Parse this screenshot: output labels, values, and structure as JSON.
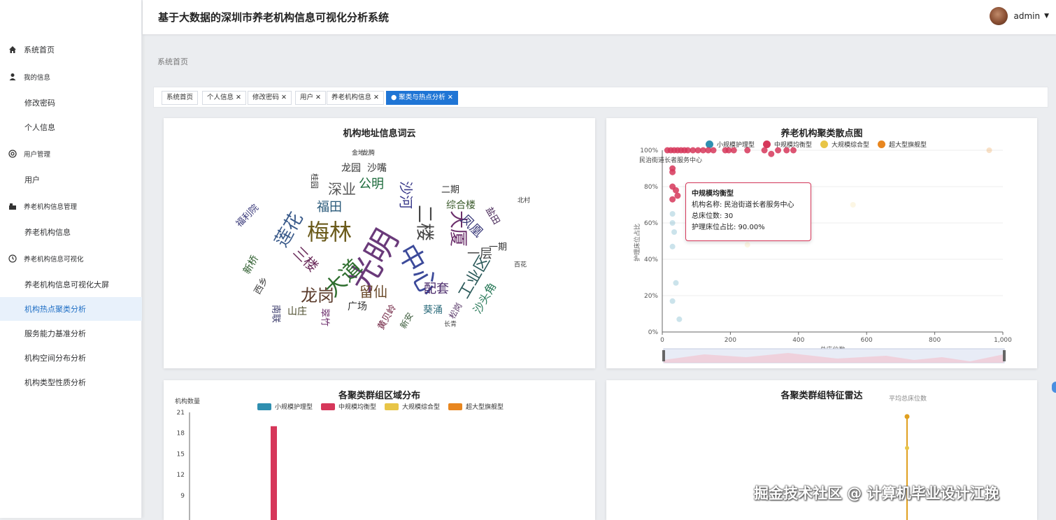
{
  "header": {
    "title": "基于大数据的深圳市养老机构信息可视化分析系统",
    "user": "admin"
  },
  "sidebar": {
    "items": [
      {
        "label": "系统首页",
        "icon": "home-icon",
        "type": "top"
      },
      {
        "label": "我的信息",
        "icon": "user-icon",
        "type": "group"
      },
      {
        "label": "修改密码",
        "type": "sub"
      },
      {
        "label": "个人信息",
        "type": "sub"
      },
      {
        "label": "用户管理",
        "icon": "users-icon",
        "type": "group"
      },
      {
        "label": "用户",
        "type": "sub"
      },
      {
        "label": "养老机构信息管理",
        "icon": "building-icon",
        "type": "group"
      },
      {
        "label": "养老机构信息",
        "type": "sub"
      },
      {
        "label": "养老机构信息可视化",
        "icon": "clock-icon",
        "type": "group"
      },
      {
        "label": "养老机构信息可视化大屏",
        "type": "sub"
      },
      {
        "label": "机构热点聚类分析",
        "type": "sub",
        "active": true
      },
      {
        "label": "服务能力基准分析",
        "type": "sub"
      },
      {
        "label": "机构空间分布分析",
        "type": "sub"
      },
      {
        "label": "机构类型性质分析",
        "type": "sub"
      }
    ]
  },
  "breadcrumb": "系统首页",
  "tabs": [
    {
      "label": "系统首页",
      "closable": false
    },
    {
      "label": "个人信息",
      "closable": true
    },
    {
      "label": "修改密码",
      "closable": true
    },
    {
      "label": "用户",
      "closable": true
    },
    {
      "label": "养老机构信息",
      "closable": true
    },
    {
      "label": "聚类与热点分析",
      "closable": true,
      "active": true
    }
  ],
  "colors": {
    "small": "#2f8fb0",
    "medium": "#d6375a",
    "large": "#e8c547",
    "xl": "#e8861f",
    "accent": "#1f75d5"
  },
  "wordcloud": {
    "title": "机构地址信息词云",
    "words": [
      {
        "text": "光明",
        "size": 46,
        "color": "#6a3a7a",
        "rot": -60
      },
      {
        "text": "中心",
        "size": 38,
        "color": "#3c4a9a",
        "rot": 60
      },
      {
        "text": "梅林",
        "size": 32,
        "color": "#6a5a1a",
        "rot": 0
      },
      {
        "text": "大道",
        "size": 30,
        "color": "#2e6e2e",
        "rot": -45
      },
      {
        "text": "莲花",
        "size": 26,
        "color": "#3a5a8a",
        "rot": -60
      },
      {
        "text": "二楼",
        "size": 26,
        "color": "#444",
        "rot": 90
      },
      {
        "text": "大厦",
        "size": 26,
        "color": "#6b2f6b",
        "rot": 90
      },
      {
        "text": "龙岗",
        "size": 24,
        "color": "#5a3a2a",
        "rot": 0
      },
      {
        "text": "工业区",
        "size": 22,
        "color": "#2b5a5a",
        "rot": -60
      },
      {
        "text": "深业",
        "size": 20,
        "color": "#555",
        "rot": 0
      },
      {
        "text": "三楼",
        "size": 20,
        "color": "#6a2a5a",
        "rot": 45
      },
      {
        "text": "沙河",
        "size": 20,
        "color": "#3a3a8a",
        "rot": 90
      },
      {
        "text": "留仙",
        "size": 20,
        "color": "#6a4a2a",
        "rot": 0
      },
      {
        "text": "福田",
        "size": 18,
        "color": "#2a5a7a",
        "rot": 0
      },
      {
        "text": "配套",
        "size": 18,
        "color": "#4a2a6a",
        "rot": 0
      },
      {
        "text": "公明",
        "size": 18,
        "color": "#1a6a3a",
        "rot": 0
      },
      {
        "text": "凤凰",
        "size": 18,
        "color": "#3a3a7a",
        "rot": 45
      },
      {
        "text": "一层",
        "size": 18,
        "color": "#444",
        "rot": 0
      },
      {
        "text": "沙头角",
        "size": 16,
        "color": "#2a7a5a",
        "rot": -60
      },
      {
        "text": "综合楼",
        "size": 14,
        "color": "#3a5a2a",
        "rot": 0
      },
      {
        "text": "龙园",
        "size": 14,
        "color": "#333",
        "rot": 0
      },
      {
        "text": "沙嘴",
        "size": 14,
        "color": "#333",
        "rot": 0
      },
      {
        "text": "广场",
        "size": 14,
        "color": "#333",
        "rot": 0
      },
      {
        "text": "葵涌",
        "size": 14,
        "color": "#2a6a7a",
        "rot": 0
      },
      {
        "text": "山庄",
        "size": 14,
        "color": "#4a4a2a",
        "rot": 0
      },
      {
        "text": "新桥",
        "size": 14,
        "color": "#2a5a2a",
        "rot": -60
      },
      {
        "text": "南联",
        "size": 13,
        "color": "#3a3a6a",
        "rot": 90
      },
      {
        "text": "翠竹",
        "size": 13,
        "color": "#6a2a6a",
        "rot": 90
      },
      {
        "text": "二期",
        "size": 13,
        "color": "#333",
        "rot": 0
      },
      {
        "text": "一期",
        "size": 13,
        "color": "#333",
        "rot": 0
      },
      {
        "text": "黄贝岭",
        "size": 13,
        "color": "#6a1a3a",
        "rot": -60
      },
      {
        "text": "西乡",
        "size": 13,
        "color": "#444",
        "rot": -60
      },
      {
        "text": "盐田",
        "size": 13,
        "color": "#4a2a5a",
        "rot": 60
      },
      {
        "text": "福利院",
        "size": 13,
        "color": "#3a3a7a",
        "rot": -45
      },
      {
        "text": "松岗",
        "size": 12,
        "color": "#5a3a6a",
        "rot": -60
      },
      {
        "text": "新安",
        "size": 12,
        "color": "#3a5a3a",
        "rot": -60
      },
      {
        "text": "桂园",
        "size": 11,
        "color": "#333",
        "rot": 90
      },
      {
        "text": "长青",
        "size": 9,
        "color": "#444",
        "rot": 0
      },
      {
        "text": "金地",
        "size": 9,
        "color": "#333",
        "rot": 0
      },
      {
        "text": "龙腾",
        "size": 9,
        "color": "#333",
        "rot": 0
      },
      {
        "text": "百花",
        "size": 9,
        "color": "#333",
        "rot": 0
      },
      {
        "text": "北村",
        "size": 9,
        "color": "#333",
        "rot": 0
      }
    ]
  },
  "scatter": {
    "title": "养老机构聚类散点图",
    "legend": [
      "小规模护理型",
      "中规模均衡型",
      "大规模综合型",
      "超大型旗舰型"
    ],
    "xlabel": "总床位数",
    "ylabel": "护理床位占比",
    "xticks": [
      "0",
      "200",
      "400",
      "600",
      "800",
      "1,000"
    ],
    "yticks": [
      "0%",
      "20%",
      "40%",
      "60%",
      "80%",
      "100%"
    ],
    "tooltip": {
      "title": "中规模均衡型",
      "lines": [
        "机构名称: 民治街道长者服务中心",
        "总床位数: 30",
        "护理床位占比: 90.00%"
      ]
    },
    "point_label": "民治街道长者服务中心"
  },
  "chart_data": [
    {
      "type": "scatter",
      "title": "养老机构聚类散点图",
      "xlabel": "总床位数",
      "ylabel": "护理床位占比",
      "xlim": [
        0,
        1000
      ],
      "ylim": [
        0,
        100
      ],
      "series": [
        {
          "name": "小规模护理型",
          "points": [
            [
              30,
              65
            ],
            [
              30,
              60
            ],
            [
              35,
              55
            ],
            [
              30,
              47
            ],
            [
              40,
              27
            ],
            [
              30,
              17
            ],
            [
              50,
              7
            ]
          ]
        },
        {
          "name": "中规模均衡型",
          "points": [
            [
              15,
              100
            ],
            [
              25,
              100
            ],
            [
              35,
              100
            ],
            [
              45,
              100
            ],
            [
              55,
              100
            ],
            [
              65,
              100
            ],
            [
              75,
              100
            ],
            [
              90,
              100
            ],
            [
              105,
              100
            ],
            [
              120,
              100
            ],
            [
              135,
              100
            ],
            [
              150,
              100
            ],
            [
              185,
              100
            ],
            [
              195,
              100
            ],
            [
              210,
              100
            ],
            [
              250,
              100
            ],
            [
              300,
              100
            ],
            [
              320,
              98
            ],
            [
              340,
              100
            ],
            [
              365,
              100
            ],
            [
              385,
              100
            ],
            [
              30,
              90
            ],
            [
              30,
              88
            ],
            [
              30,
              80
            ],
            [
              40,
              78
            ],
            [
              30,
              73
            ],
            [
              45,
              75
            ]
          ]
        },
        {
          "name": "大规模综合型",
          "points": [
            [
              250,
              48
            ],
            [
              400,
              60
            ],
            [
              560,
              70
            ]
          ]
        },
        {
          "name": "超大型旗舰型",
          "points": [
            [
              960,
              100
            ]
          ]
        }
      ]
    },
    {
      "type": "bar",
      "title": "各聚类群组区域分布",
      "ylabel": "机构数量",
      "yticks": [
        9,
        12,
        15,
        18,
        21
      ],
      "ylim": [
        0,
        21
      ],
      "series": [
        {
          "name": "中规模均衡型",
          "values": [
            19
          ]
        }
      ]
    },
    {
      "type": "radar",
      "title": "各聚类群组特征雷达",
      "axis_label": "平均总床位数"
    }
  ],
  "bar": {
    "title": "各聚类群组区域分布",
    "ylabel": "机构数量",
    "legend": [
      "小规模护理型",
      "中规模均衡型",
      "大规模综合型",
      "超大型旗舰型"
    ],
    "yticks": [
      "21",
      "18",
      "15",
      "12",
      "9"
    ]
  },
  "radar": {
    "title": "各聚类群组特征雷达",
    "axis_label": "平均总床位数"
  },
  "watermark": "掘金技术社区 @ 计算机毕业设计江挽"
}
